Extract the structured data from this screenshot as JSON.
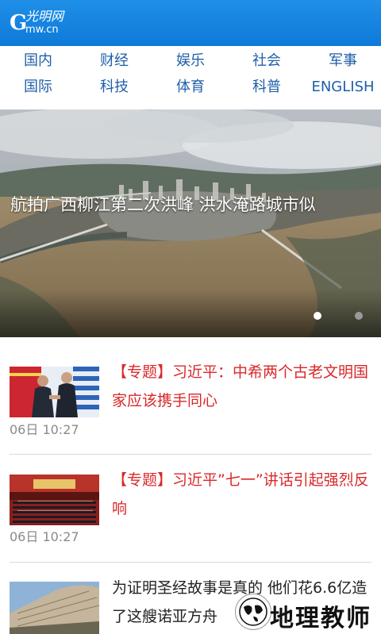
{
  "header": {
    "logo_letter": "G",
    "logo_script": "光明网",
    "logo_domain": "mw.cn"
  },
  "nav": {
    "items": [
      "国内",
      "财经",
      "娱乐",
      "社会",
      "军事",
      "国际",
      "科技",
      "体育",
      "科普",
      "ENGLISH"
    ]
  },
  "banner": {
    "caption": "航拍广西柳江第二次洪峰 洪水淹路城市似",
    "dots_total": 2,
    "dots_active": 1
  },
  "news": [
    {
      "topic_tag": "【专题】",
      "title": "习近平：中希两个古老文明国家应该携手同心",
      "time": "06日 10:27"
    },
    {
      "topic_tag": "【专题】",
      "title": "习近平”七一”讲话引起强烈反响",
      "time": "06日 10:27"
    },
    {
      "topic_tag": "",
      "title": "为证明圣经故事是真的 他们花6.6亿造了这艘诺亚方舟",
      "time": ""
    }
  ],
  "watermark": {
    "text": "地理教师"
  },
  "colors": {
    "header_blue": "#1487e0",
    "nav_text": "#1f5fa8",
    "topic_red": "#d9282a",
    "time_gray": "#8a8a8a"
  }
}
